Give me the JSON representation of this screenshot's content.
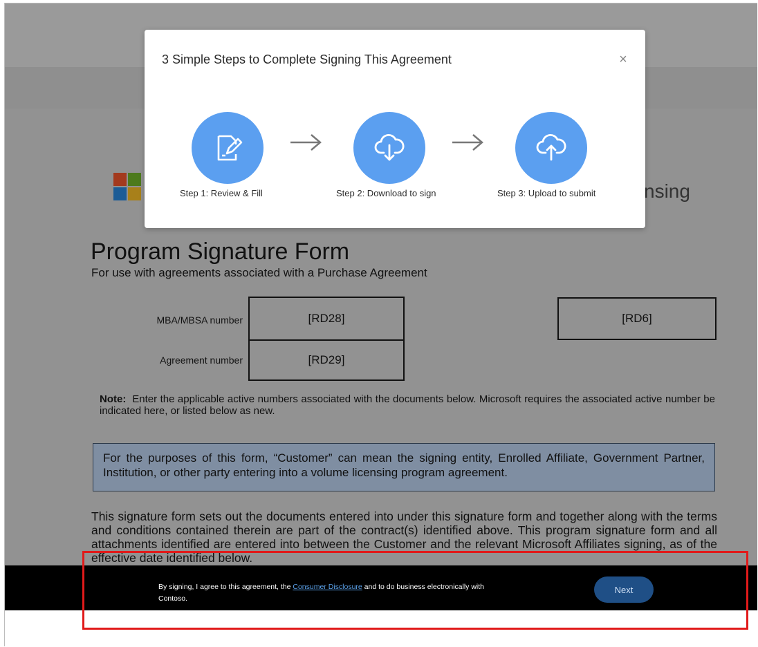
{
  "modal": {
    "title": "3 Simple Steps to Complete Signing This Agreement",
    "close_glyph": "×",
    "steps": [
      {
        "label": "Step 1: Review & Fill",
        "icon": "edit-document-icon"
      },
      {
        "label": "Step 2: Download to sign",
        "icon": "cloud-download-icon"
      },
      {
        "label": "Step 3: Upload to submit",
        "icon": "cloud-upload-icon"
      }
    ],
    "arrow_glyph": "→"
  },
  "document": {
    "licensing_tail": "nsing",
    "title": "Program Signature Form",
    "subtitle": "For use with agreements associated with a Purchase Agreement",
    "fields": {
      "mba_label": "MBA/MBSA number",
      "mba_value": "[RD28]",
      "agreement_label": "Agreement number",
      "agreement_value": "[RD29]",
      "right_value": "[RD6]"
    },
    "note_label": "Note:",
    "note_text": "Enter the applicable active numbers associated with the documents below.  Microsoft requires the associated active number be indicated here, or listed below as new.",
    "customer_definition": "For the purposes of this form, “Customer” can mean the signing entity, Enrolled Affiliate, Government Partner, Institution, or other party entering into a volume licensing program agreement.",
    "body_paragraph": "This signature form sets out the documents entered into under this signature form and together along with the terms and conditions contained therein are part of the contract(s) identified above.  This program signature form and all attachments identified are entered into between the Customer and the relevant Microsoft Affiliates signing, as of the effective date identified below."
  },
  "consent_bar": {
    "text_before": "By signing, I agree to this agreement, the ",
    "link_text": "Consumer Disclosure",
    "text_after": " and to do business electronically with Contoso.",
    "next_label": "Next"
  },
  "colors": {
    "accent_blue": "#5b9ff0",
    "next_button": "#1f4f86",
    "highlight_red": "#e11a1a"
  }
}
